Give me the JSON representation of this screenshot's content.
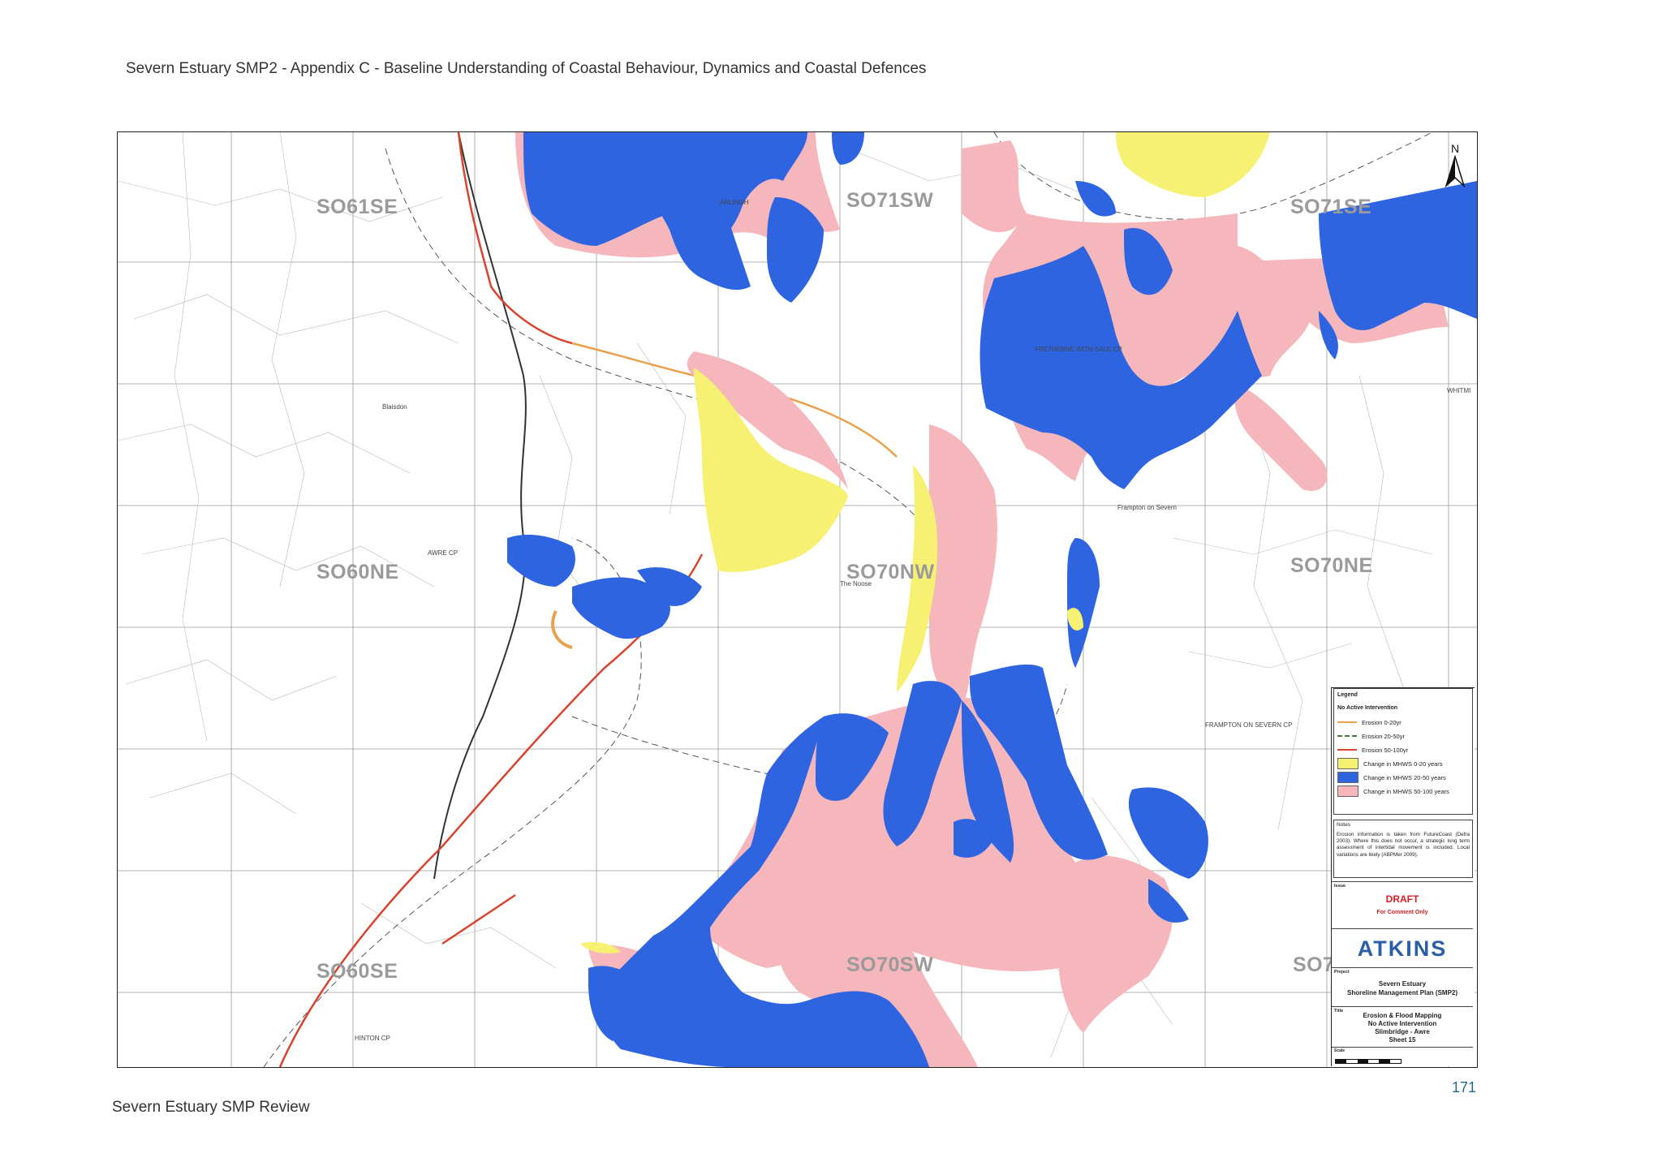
{
  "page": {
    "header": "Severn Estuary SMP2 - Appendix C - Baseline Understanding of Coastal Behaviour, Dynamics and Coastal Defences",
    "footer": "Severn Estuary SMP Review",
    "page_number": "171"
  },
  "map": {
    "sheet_labels": [
      "SO61SE",
      "SO71SW",
      "SO71SE",
      "SO60NE",
      "SO70NW",
      "SO70NE",
      "SO60SE",
      "SO70SW",
      "SO7"
    ],
    "place_labels": [
      "FRETHERNE WITH SAUL CP",
      "AWRE CP",
      "FRAMPTON ON SEVERN CP",
      "HINTON CP",
      "ARLINGH",
      "WHITMI",
      "Frampton on Severn",
      "The Noose",
      "Blaisdon"
    ],
    "north_label": "N",
    "colors": {
      "change_0_20": "#f7f173",
      "change_20_50": "#2e64e0",
      "change_50_100": "#f5b6bc",
      "erosion_0_20": "#e8a14c",
      "erosion_20_50": "#4a7a3a",
      "erosion_50_100": "#d8432e"
    }
  },
  "legend": {
    "title": "Legend",
    "subtitle": "No Active Intervention",
    "items": [
      {
        "label": "Erosion 0-20yr",
        "kind": "line",
        "style": "solid",
        "color": "#e8a14c"
      },
      {
        "label": "Erosion 20-50yr",
        "kind": "line",
        "style": "dashed",
        "color": "#4a7a3a"
      },
      {
        "label": "Erosion 50-100yr",
        "kind": "line",
        "style": "solid",
        "color": "#d8432e"
      },
      {
        "label": "Change in MHWS 0-20 years",
        "kind": "swatch",
        "color": "#f7f173"
      },
      {
        "label": "Change in MHWS 20-50 years",
        "kind": "swatch",
        "color": "#2e64e0"
      },
      {
        "label": "Change in MHWS 50-100 years",
        "kind": "swatch",
        "color": "#f5b6bc"
      }
    ]
  },
  "notes": {
    "title": "Notes",
    "text": "Erosion information is taken from FutureCoast (Defra 2003). Where this does not occur, a strategic long term assessment of intertidal movement is included. Local variations are likely (ABPMer 2009)."
  },
  "title_block": {
    "issue_label": "Issue",
    "status": "DRAFT",
    "status_note": "For Comment Only",
    "logo": "ATKINS",
    "project_label": "Project",
    "project_line1": "Severn Estuary",
    "project_line2": "Shoreline Management Plan (SMP2)",
    "title_label": "Title",
    "title_line1": "Erosion & Flood Mapping",
    "title_line2": "No Active Intervention",
    "title_line3": "Slimbridge - Awre",
    "title_line4": "Sheet 15",
    "scale_label": "Scale"
  }
}
